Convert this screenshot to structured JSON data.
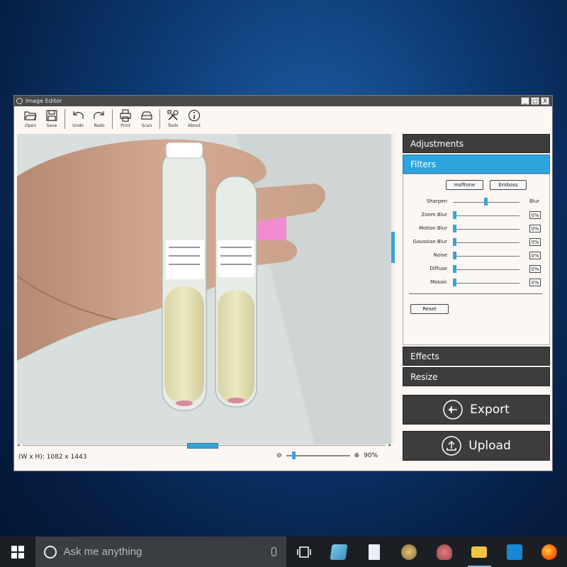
{
  "window": {
    "title": "Image Editor",
    "controls": [
      "_",
      "□",
      "X"
    ]
  },
  "toolbar": {
    "open": "Open",
    "save": "Save",
    "undo": "Undo",
    "redo": "Redo",
    "print": "Print",
    "scan": "Scan",
    "tools": "Tools",
    "about": "About"
  },
  "status": {
    "dimensions": "(W x H): 1082 x 1443",
    "zoom": "90%",
    "zoom_level": 0.1
  },
  "panel": {
    "adjustments": "Adjustments",
    "filters": "Filters",
    "effects": "Effects",
    "resize": "Resize",
    "halftone": "Halftone",
    "emboss": "Emboss",
    "sharpen": "Sharpen",
    "blur": "Blur",
    "sharpen_blur_level": 0.5,
    "rows": [
      {
        "label": "Zoom Blur",
        "value": "0%"
      },
      {
        "label": "Motion Blur",
        "value": "0%"
      },
      {
        "label": "Gaussian Blur",
        "value": "0%"
      },
      {
        "label": "Noise",
        "value": "0%"
      },
      {
        "label": "Diffuse",
        "value": "0%"
      },
      {
        "label": "Mosaic",
        "value": "0%"
      }
    ],
    "reset": "Reset"
  },
  "actions": {
    "export": "Export",
    "upload": "Upload"
  },
  "taskbar": {
    "search_placeholder": "Ask me anything"
  },
  "colors": {
    "accent": "#2ea4dc",
    "dark": "#3d3d3d"
  }
}
